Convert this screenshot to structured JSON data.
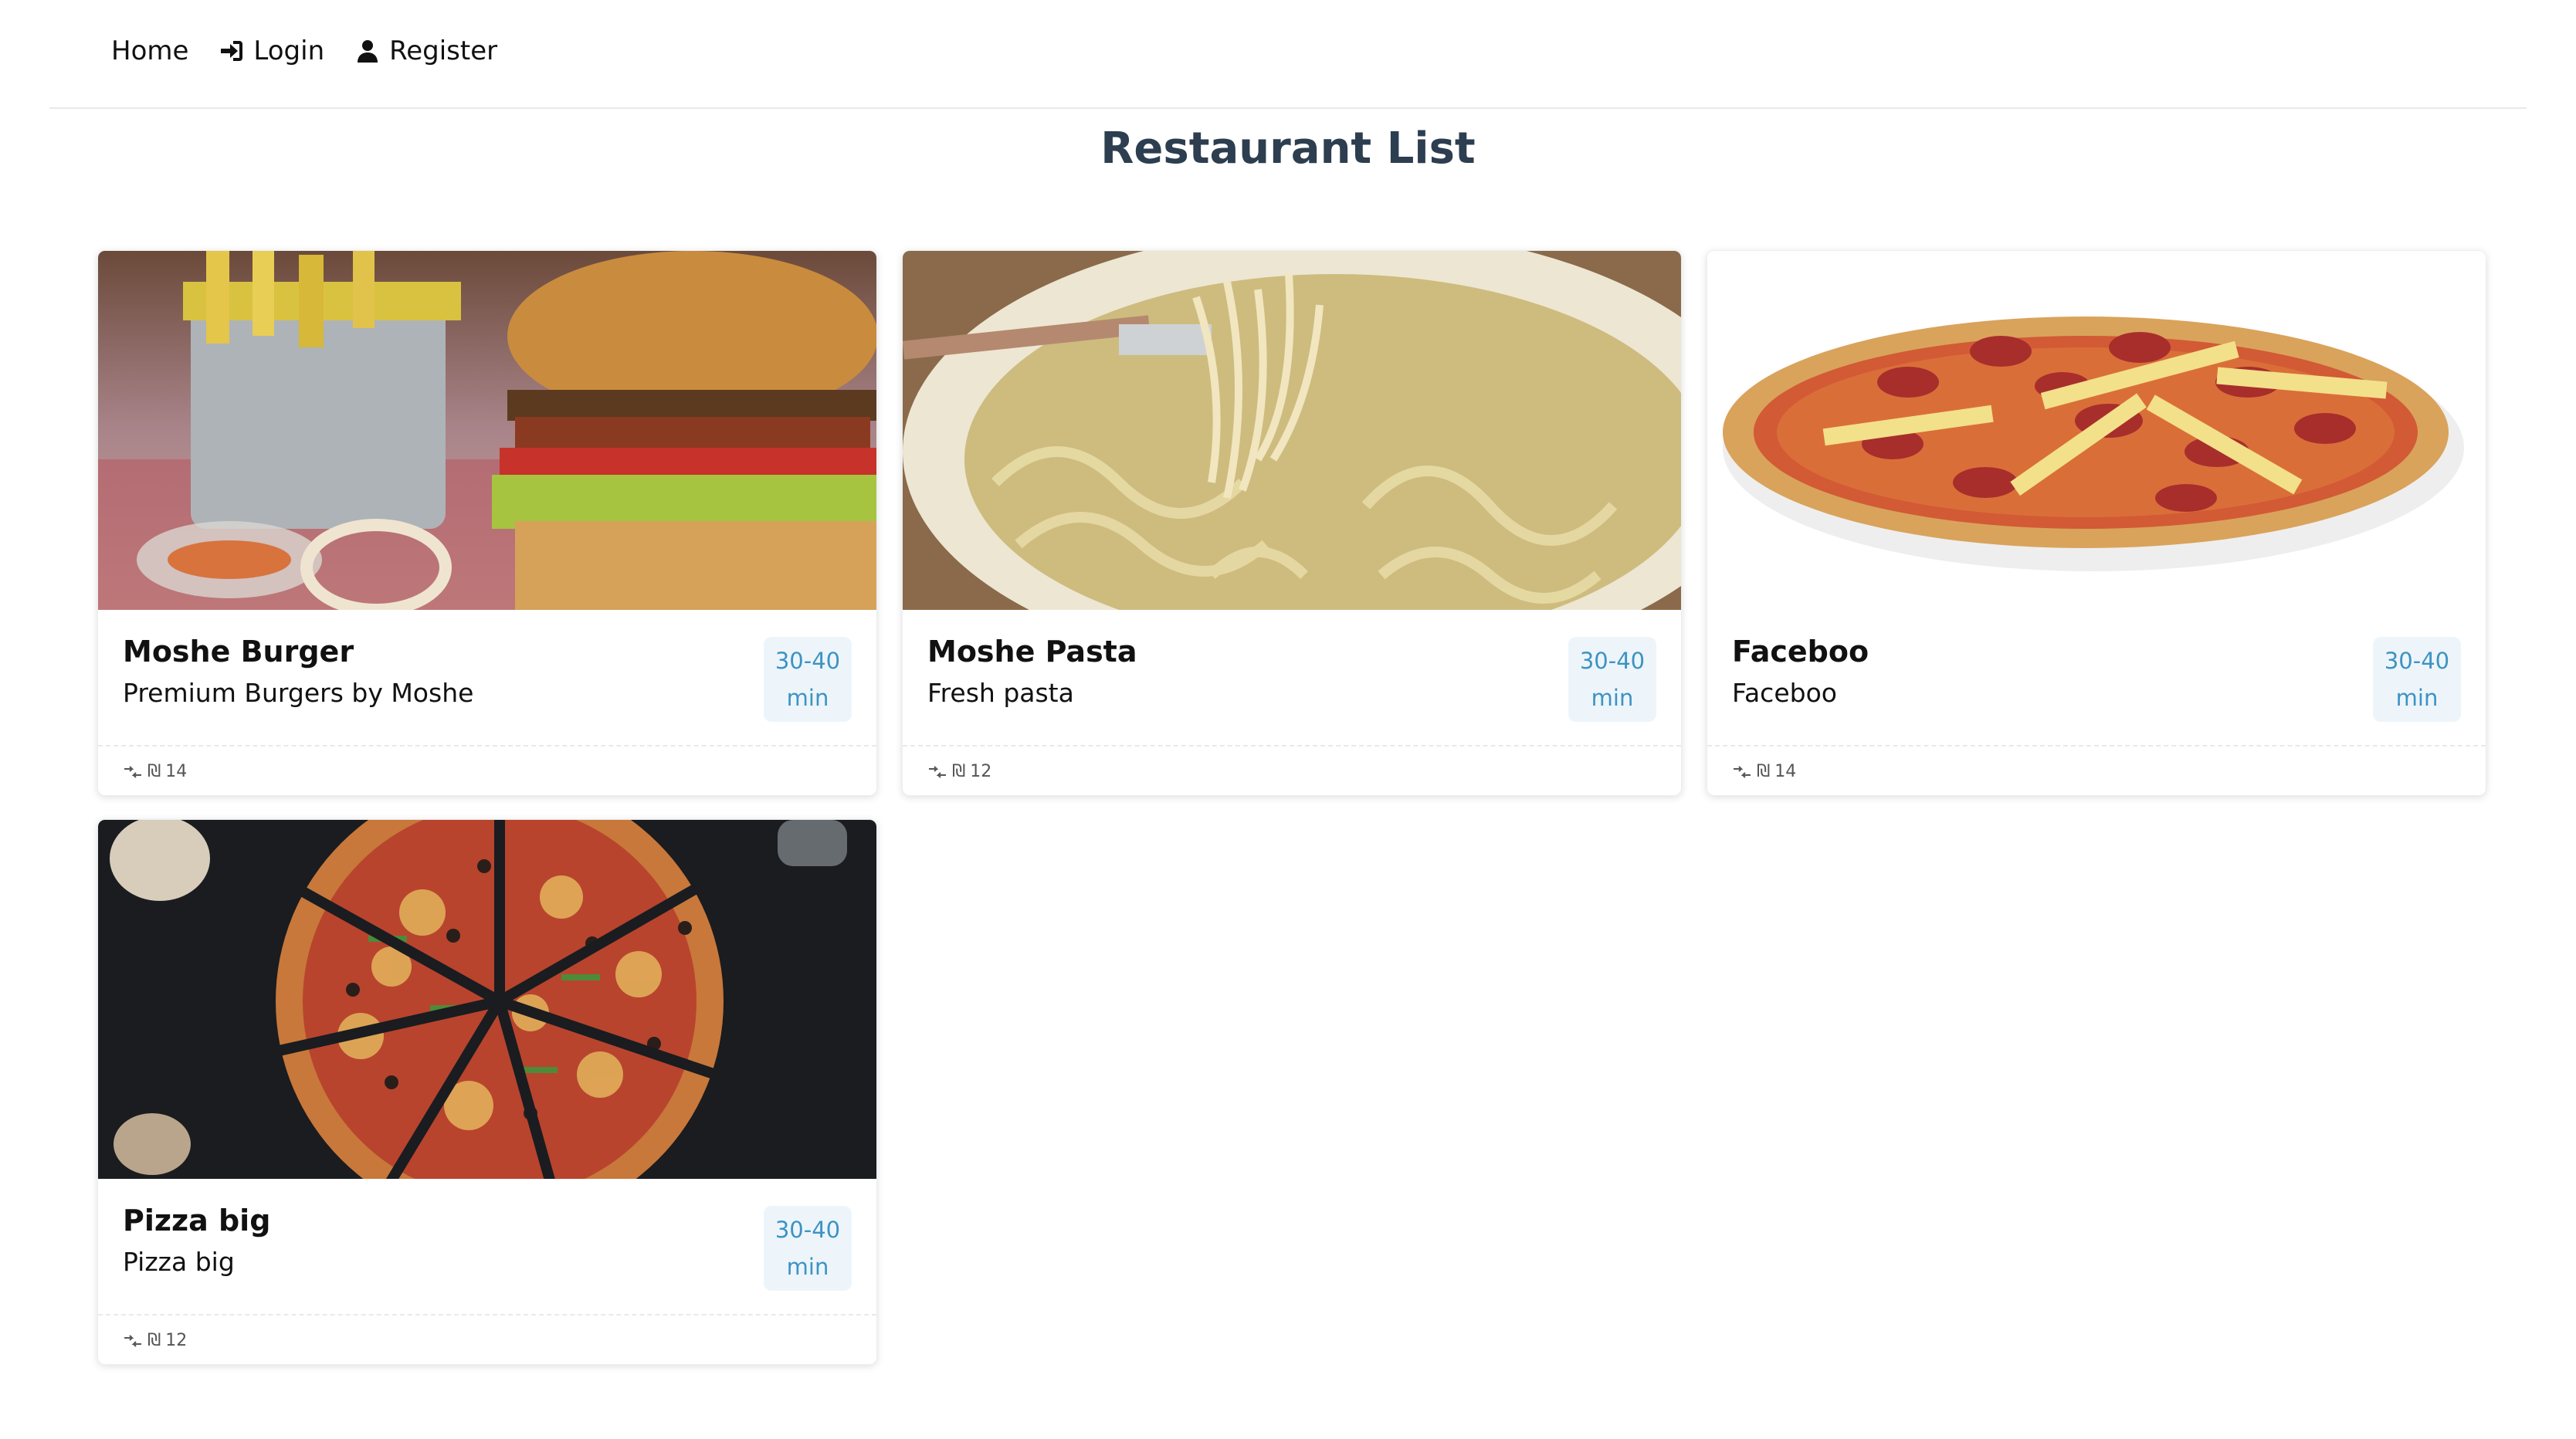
{
  "nav": {
    "home": "Home",
    "login": "Login",
    "register": "Register"
  },
  "page": {
    "title": "Restaurant List"
  },
  "restaurants": [
    {
      "name": "Moshe Burger",
      "description": "Premium Burgers by Moshe",
      "time_range": "30-40",
      "time_unit": "min",
      "currency": "₪",
      "delivery_fee": "14",
      "image": "burger-photo"
    },
    {
      "name": "Moshe Pasta",
      "description": "Fresh pasta",
      "time_range": "30-40",
      "time_unit": "min",
      "currency": "₪",
      "delivery_fee": "12",
      "image": "pasta-photo"
    },
    {
      "name": "Faceboo",
      "description": "Faceboo",
      "time_range": "30-40",
      "time_unit": "min",
      "currency": "₪",
      "delivery_fee": "14",
      "image": "pizza-plate-photo"
    },
    {
      "name": "Pizza big",
      "description": "Pizza big",
      "time_range": "30-40",
      "time_unit": "min",
      "currency": "₪",
      "delivery_fee": "12",
      "image": "sliced-pizza-photo"
    }
  ],
  "colors": {
    "title": "#2c3e50",
    "badge_text": "#3d93c4",
    "badge_bg": "#edf5fa"
  }
}
